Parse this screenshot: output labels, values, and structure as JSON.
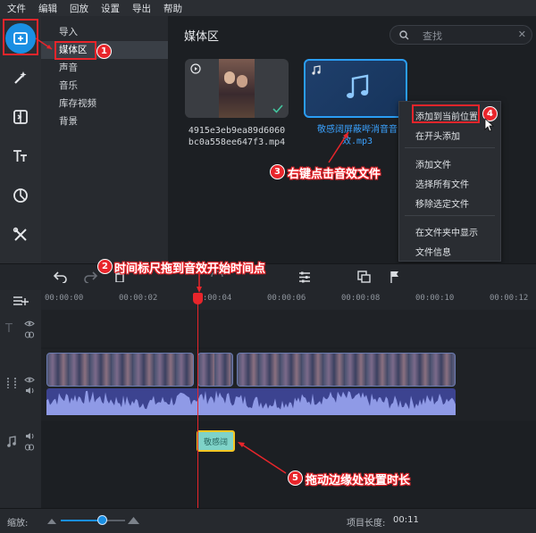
{
  "menubar": {
    "items": [
      "文件",
      "编辑",
      "回放",
      "设置",
      "导出",
      "帮助"
    ]
  },
  "tools": [
    "import-icon",
    "magic-wand-icon",
    "transition-icon",
    "title-icon",
    "filter-icon",
    "more-tools-icon"
  ],
  "categories": [
    "导入",
    "媒体区",
    "声音",
    "音乐",
    "库存视频",
    "背景"
  ],
  "media": {
    "title": "媒体区",
    "search_placeholder": "查找",
    "items": [
      {
        "caption_line1": "4915e3eb9ea89d6060",
        "caption_line2": "bc0a558ee647f3.mp4"
      },
      {
        "caption_line1": "敬感阔屏蔽哔消音音",
        "caption_line2": "效.mp3"
      }
    ]
  },
  "context_menu": {
    "items": [
      "添加到当前位置",
      "在开头添加",
      "添加文件",
      "选择所有文件",
      "移除选定文件",
      "在文件夹中显示",
      "文件信息"
    ]
  },
  "timeline": {
    "ticks": [
      "00:00:00",
      "00:00:02",
      "00:00:04",
      "00:00:06",
      "00:00:08",
      "00:00:10",
      "00:00:12"
    ],
    "audio_clip_label": "敬感阔"
  },
  "status": {
    "zoom_label": "缩放:",
    "duration_label": "项目长度:",
    "duration_value": "00:11"
  },
  "annotations": {
    "a1": "1",
    "a2": "2",
    "a2_text": "时间标尺拖到音效开始时间点",
    "a3": "3",
    "a3_text": "右键点击音效文件",
    "a4": "4",
    "a5": "5",
    "a5_text": "拖动边缘处设置时长"
  },
  "colors": {
    "accent": "#1a8fe3",
    "annotation": "#e8252b",
    "playhead": "#e8252b",
    "audio_wave": "#5a66c7",
    "audio_clip": "#7fd3c8"
  }
}
